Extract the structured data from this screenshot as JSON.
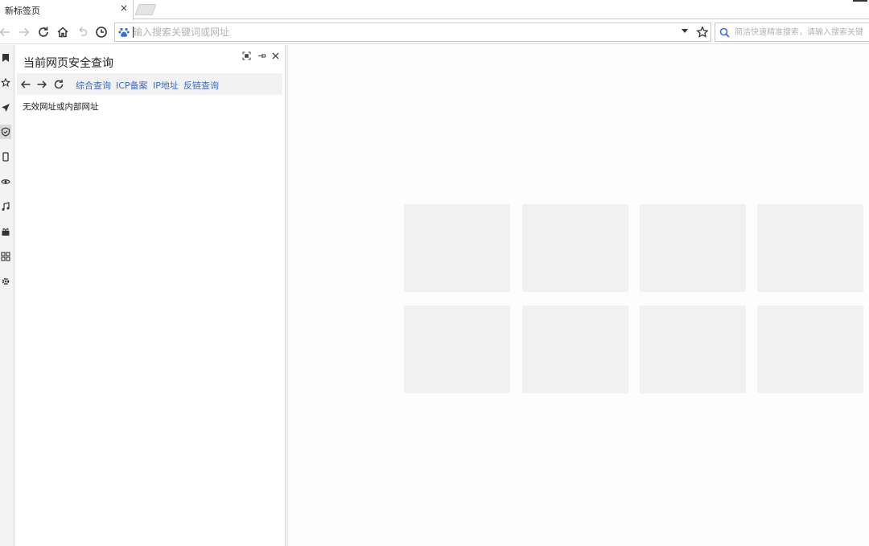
{
  "tab": {
    "title": "新标签页",
    "close": "×"
  },
  "toolbar": {
    "url_placeholder": "输入搜索关键词或网址",
    "search_placeholder": "简洁快速精准搜索，请输入搜索关键"
  },
  "rail": {
    "items": [
      "bookmark-icon",
      "favorite-star-icon",
      "send-icon",
      "shield-icon",
      "phone-icon",
      "eye-icon",
      "music-note-icon",
      "gift-icon",
      "apps-icon",
      "gear-icon"
    ],
    "active_index": 3
  },
  "panel": {
    "title": "当前网页安全查询",
    "links": [
      "综合查询",
      "ICP备案",
      "IP地址",
      "反链查询"
    ],
    "message": "无效网址或内部网址"
  },
  "main": {
    "tile_count": 8
  },
  "colors": {
    "link": "#3d6bc4",
    "tile": "#f1f1f1",
    "nav_bg": "#f2f2f2",
    "baidu_blue": "#2f6fe0"
  }
}
